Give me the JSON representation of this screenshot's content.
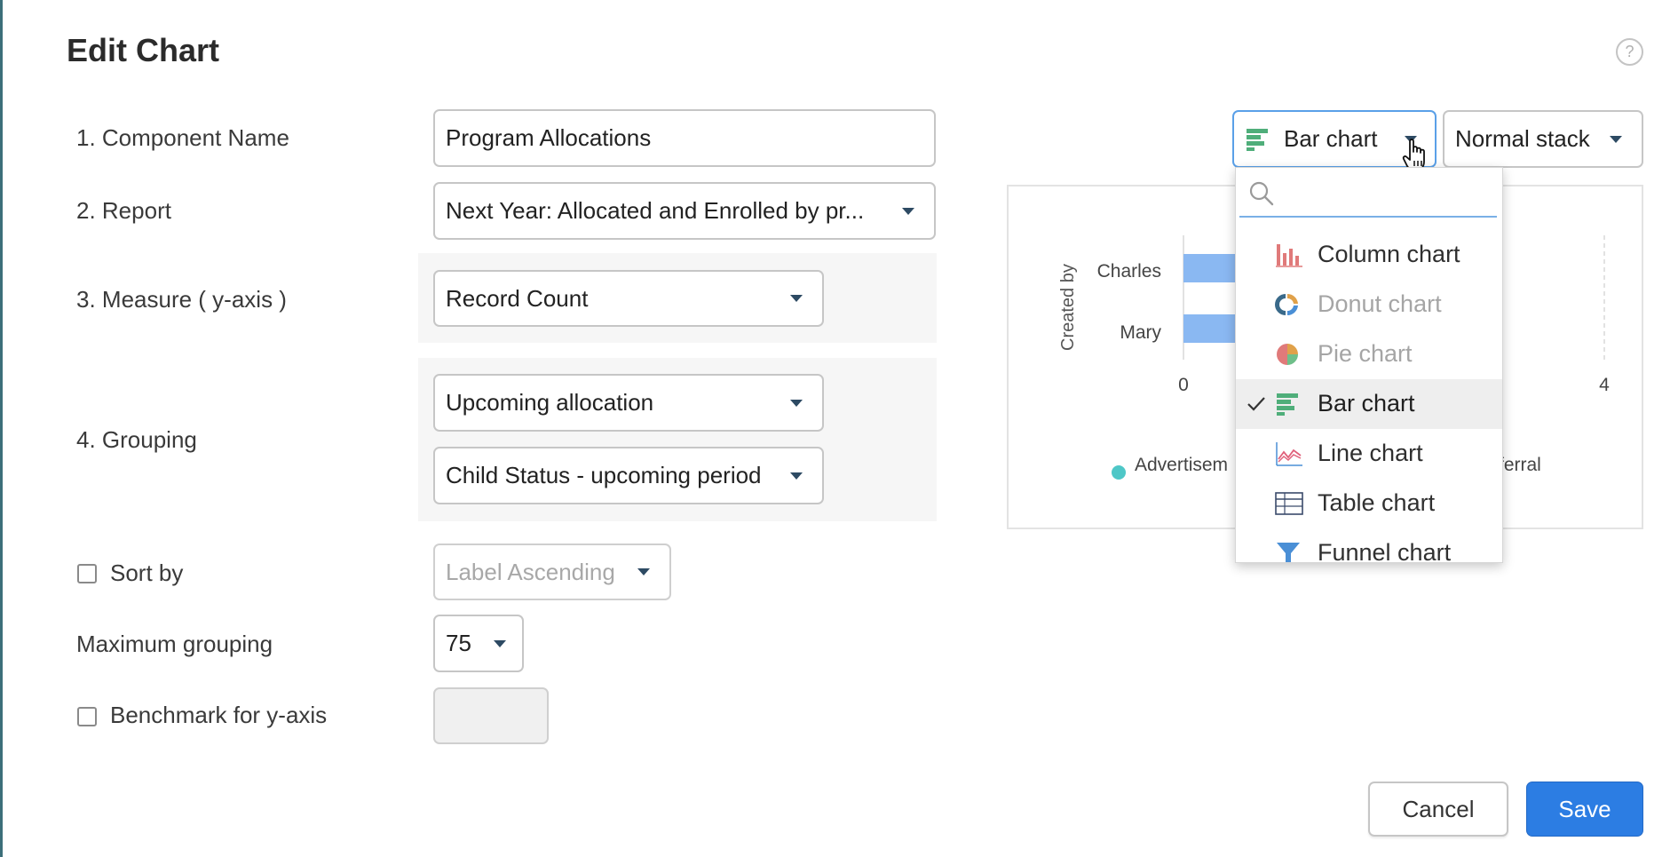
{
  "dialog": {
    "title": "Edit Chart",
    "help_icon": "?"
  },
  "form": {
    "component_name": {
      "label": "1. Component Name",
      "value": "Program Allocations"
    },
    "report": {
      "label": "2. Report",
      "value": "Next Year: Allocated and Enrolled by pr..."
    },
    "measure": {
      "label": "3. Measure ( y-axis )",
      "value": "Record Count"
    },
    "grouping": {
      "label": "4. Grouping",
      "value1": "Upcoming allocation",
      "value2": "Child Status - upcoming period"
    },
    "sort_by": {
      "label": "Sort by",
      "value": "Label Ascending",
      "checked": false
    },
    "max_grouping": {
      "label": "Maximum grouping",
      "value": "75"
    },
    "benchmark": {
      "label": "Benchmark for y-axis",
      "value": "",
      "checked": false
    }
  },
  "chart_type": {
    "selected": "Bar chart",
    "stack": "Normal stack"
  },
  "dropdown": {
    "search_placeholder": "",
    "items": [
      {
        "label": "Column chart",
        "icon": "column-chart-icon"
      },
      {
        "label": "Donut chart",
        "icon": "donut-chart-icon"
      },
      {
        "label": "Pie chart",
        "icon": "pie-chart-icon"
      },
      {
        "label": "Bar chart",
        "icon": "bar-chart-icon",
        "selected": true
      },
      {
        "label": "Line chart",
        "icon": "line-chart-icon"
      },
      {
        "label": "Table chart",
        "icon": "table-chart-icon"
      },
      {
        "label": "Funnel chart",
        "icon": "funnel-chart-icon"
      }
    ]
  },
  "preview": {
    "axis_label": "Created by",
    "categories": [
      "Charles",
      "Mary"
    ],
    "ticks": [
      "0",
      "4"
    ],
    "legend": [
      "Advertisem",
      "ferral"
    ]
  },
  "footer": {
    "cancel": "Cancel",
    "save": "Save"
  },
  "colors": {
    "primary": "#2c7de3",
    "bar": "#8ab8f2",
    "legend_dot": "#4ec7c7",
    "accent_green": "#4fae7a"
  }
}
